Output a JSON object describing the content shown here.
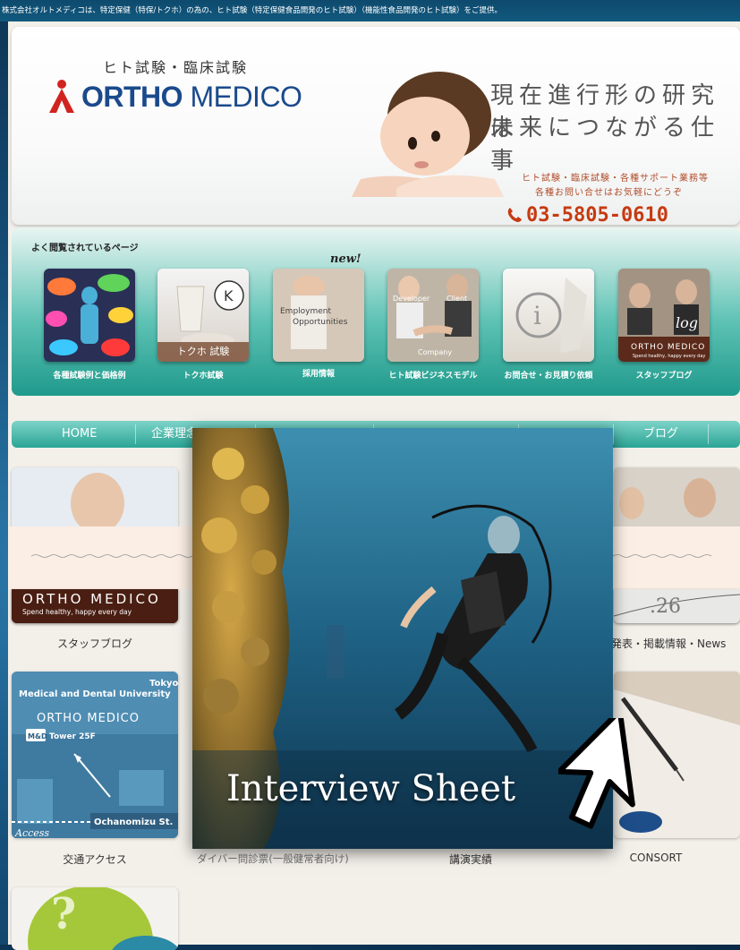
{
  "topline": "株式会社オルトメディコは、特定保健（特保/トクホ）の為の、ヒト試験（特定保健食品開発のヒト試験）（機能性食品開発のヒト試験）をご提供。",
  "header": {
    "subtitle": "ヒト試験・臨床試験",
    "logo_word1": "ORTHO",
    "logo_word2": "MEDICO",
    "catch_line1": "現在進行形の研究は",
    "catch_line2": "未来につながる仕事",
    "note_line1": "ヒト試験・臨床試験・各種サポート業務等",
    "note_line2": "各種お問い合せはお気軽にどうぞ",
    "phone": "03-5805-0610"
  },
  "popular": {
    "title": "よく閲覧されているページ",
    "new_badge": "new!",
    "tiles": [
      {
        "label": "各種試験例と価格例"
      },
      {
        "label": "トクホ試験",
        "caption": "トクホ 試験"
      },
      {
        "label": "採用情報",
        "caption1": "Employment",
        "caption2": "Opportunities"
      },
      {
        "label": "ヒト試験ビジネスモデル",
        "caption1": "Developer",
        "caption2": "Client",
        "caption3": "Company"
      },
      {
        "label": "お問合せ・お見積り依頼"
      },
      {
        "label": "スタッフブログ",
        "caption1": "ORTHO MEDICO",
        "caption2": "Spend healthy, happy every day",
        "caption3": "log"
      }
    ]
  },
  "nav": {
    "items": [
      "HOME",
      "企業理念",
      "ブログ"
    ]
  },
  "cards": {
    "staff_blog_label": "スタッフブログ",
    "staff_blog_brand": "ORTHO MEDICO",
    "staff_blog_tagline": "Spend healthy, happy every day",
    "news_label": "発表・掲載情報・News",
    "access_label": "交通アクセス",
    "access_map_title1": "Tokyo",
    "access_map_title2": "Medical and Dental University",
    "access_map_brand": "ORTHO MEDICO",
    "access_map_tower_tag": "M&D",
    "access_map_tower": "Tower 25F",
    "access_map_station": "Ochanomizu St.",
    "access_map_script": "Access",
    "lecture_label": "講演実績",
    "consort_label": "CONSORT"
  },
  "modal": {
    "title": "Interview Sheet",
    "caption": "ダイバー問診票(一般健常者向け)"
  },
  "colors": {
    "accent_teal": "#2aa596",
    "brand_blue": "#1a4a8c",
    "phone_red": "#c63a10",
    "note_brown": "#b24e2c"
  }
}
